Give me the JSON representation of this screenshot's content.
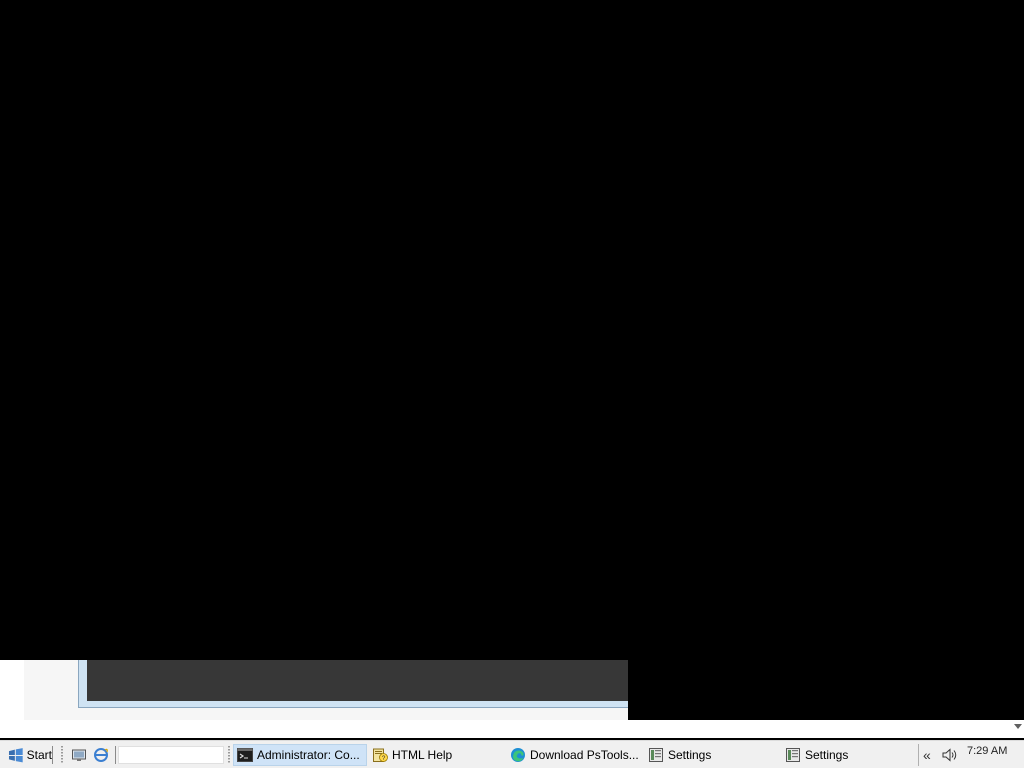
{
  "taskbar": {
    "start_label": "Start",
    "tasks": [
      {
        "label": "Administrator: Co...",
        "icon": "cmd-icon",
        "active": true
      },
      {
        "label": "HTML Help",
        "icon": "help-icon",
        "active": false
      },
      {
        "label": "Download PsTools...",
        "icon": "edge-icon",
        "active": false
      },
      {
        "label": "Settings",
        "icon": "settings-icon",
        "active": false
      },
      {
        "label": "Settings",
        "icon": "settings-icon",
        "active": false
      }
    ],
    "quick_launch": [
      "show-desktop-icon",
      "ie-icon"
    ],
    "address_value": "",
    "tray": {
      "chevron": "«",
      "clock": "7:29 AM"
    }
  },
  "colors": {
    "taskbar_bg": "#f0f0f0",
    "active_task_bg": "#cfe3f7",
    "console_frame": "#cfe3f3",
    "console_body": "#373737"
  }
}
